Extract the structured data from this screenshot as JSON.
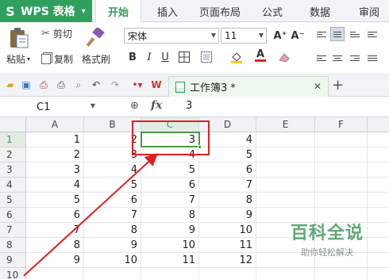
{
  "app": {
    "title": "WPS 表格",
    "logo": "S"
  },
  "menu": {
    "tabs": [
      "开始",
      "插入",
      "页面布局",
      "公式",
      "数据",
      "审阅"
    ],
    "active": 0
  },
  "ribbon": {
    "paste": "粘贴",
    "cut": "剪切",
    "copy": "复制",
    "format_painter": "格式刷",
    "font_name": "宋体",
    "font_size": "11",
    "font_grow": "A⁺",
    "font_shrink": "A⁻",
    "bold": "B",
    "italic": "I",
    "underline": "U",
    "font_color_letter": "A"
  },
  "doc": {
    "tab_title": "工作簿3 *"
  },
  "formula": {
    "name_box": "C1",
    "fx_label": "fx",
    "value": "3"
  },
  "grid": {
    "columns": [
      "A",
      "B",
      "C",
      "D",
      "E",
      "F"
    ],
    "selected_column": "C",
    "rows": [
      "1",
      "2",
      "3",
      "4",
      "5",
      "6",
      "7",
      "8",
      "9",
      "10"
    ],
    "selected_row": "1",
    "cells": [
      [
        "1",
        "2",
        "3",
        "4"
      ],
      [
        "2",
        "3",
        "4",
        "5"
      ],
      [
        "3",
        "4",
        "5",
        "6"
      ],
      [
        "4",
        "5",
        "6",
        "7"
      ],
      [
        "5",
        "6",
        "7",
        "8"
      ],
      [
        "6",
        "7",
        "8",
        "9"
      ],
      [
        "7",
        "8",
        "9",
        "10"
      ],
      [
        "8",
        "9",
        "10",
        "11"
      ],
      [
        "9",
        "10",
        "11",
        "12"
      ]
    ],
    "active_cell": "C1"
  },
  "watermark": {
    "title": "百科全说",
    "subtitle": "助你轻松解决"
  },
  "colors": {
    "brand_green": "#2f9f5e",
    "annotation_red": "#e02020",
    "selection_green": "#4a9a4a"
  }
}
